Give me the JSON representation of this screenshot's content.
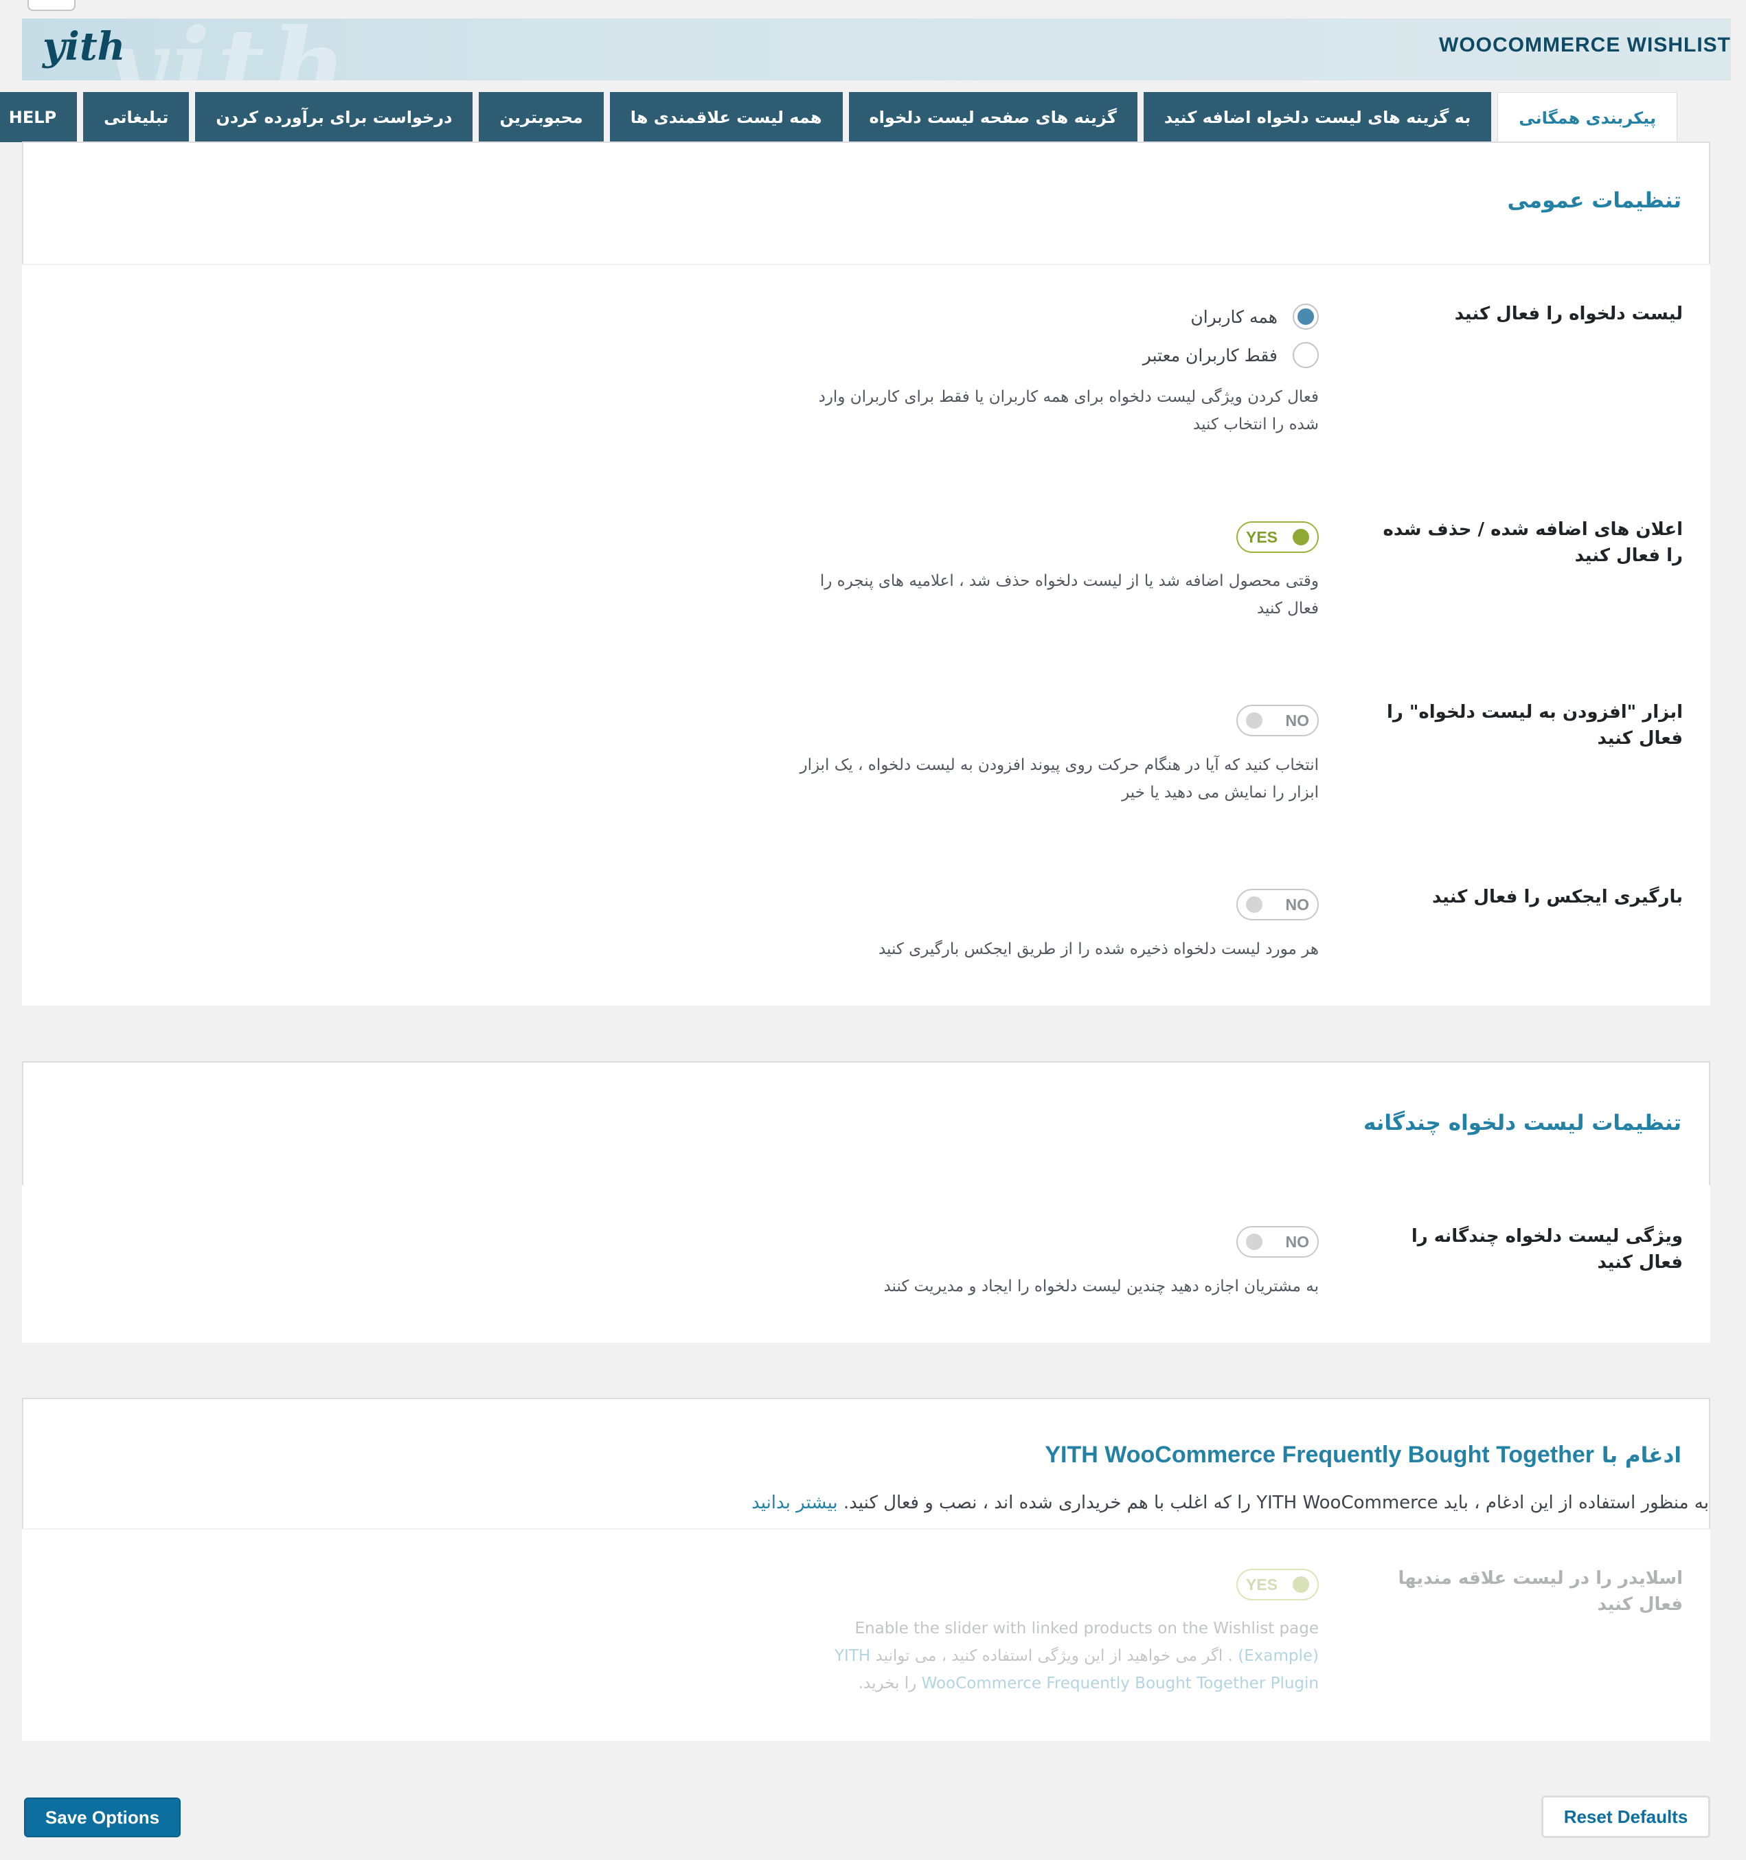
{
  "header": {
    "logo": "yith",
    "title": "WOOCOMMERCE WISHLIST"
  },
  "tabs": [
    {
      "label": "پیکربندی همگانی",
      "active": true
    },
    {
      "label": "به گزینه های لیست دلخواه اضافه کنید"
    },
    {
      "label": "گزینه های صفحه لیست دلخواه"
    },
    {
      "label": "همه لیست علاقمندی ها"
    },
    {
      "label": "محبوبترین"
    },
    {
      "label": "درخواست برای برآورده کردن"
    },
    {
      "label": "تبلیغاتی"
    },
    {
      "label": "HELP"
    }
  ],
  "general": {
    "title": "تنظیمات عمومی",
    "enable_wishlist": {
      "label": "لیست دلخواه را فعال کنید",
      "options": [
        "همه کاربران",
        "فقط کاربران معتبر"
      ],
      "selected": "همه کاربران",
      "description": "فعال کردن ویژگی لیست دلخواه برای همه کاربران یا فقط برای کاربران وارد شده را انتخاب کنید"
    },
    "notices": {
      "label": "اعلان های اضافه شده / حذف شده را فعال کنید",
      "state": "YES",
      "description": "وقتی محصول اضافه شد یا از لیست دلخواه حذف شد ، اعلامیه های پنجره را فعال کنید"
    },
    "tooltip": {
      "label": "ابزار \"افزودن به لیست دلخواه\" را فعال کنید",
      "state": "NO",
      "description": "انتخاب کنید که آیا در هنگام حرکت روی پیوند افزودن به لیست دلخواه ، یک ابزار ابزار را نمایش می دهید یا خیر"
    },
    "ajax": {
      "label": "بارگیری ایجکس را فعال کنید",
      "state": "NO",
      "description": "هر مورد لیست دلخواه ذخیره شده را از طریق ایجکس بارگیری کنید"
    }
  },
  "multi": {
    "title": "تنظیمات لیست دلخواه چندگانه",
    "feature": {
      "label": "ویژگی لیست دلخواه چندگانه را فعال کنید",
      "state": "NO",
      "description": "به مشتریان اجازه دهید چندین لیست دلخواه را ایجاد و مدیریت کنند"
    }
  },
  "integration": {
    "title_prefix": "ادغام با",
    "title_plugin": "YITH WooCommerce Frequently Bought Together",
    "intro_text": "به منظور استفاده از این ادغام ، باید YITH WooCommerce را که اغلب با هم خریداری شده اند ، نصب و فعال کنید.",
    "intro_link": "بیشتر بدانید",
    "slider": {
      "label": "اسلایدر را در لیست علاقه مندیها فعال کنید",
      "state": "YES",
      "desc_en": "Enable the slider with linked products on the Wishlist page",
      "desc_example": "(Example)",
      "desc_fa": ". اگر می خواهید از این ویژگی استفاده کنید ، می توانید",
      "desc_plugin": "YITH WooCommerce Frequently Bought Together Plugin",
      "desc_end": "را بخرید."
    }
  },
  "buttons": {
    "save": "Save Options",
    "reset": "Reset Defaults"
  },
  "colors": {
    "accent": "#2481a6",
    "tab_bg": "#2e5c73",
    "button": "#0d6fa0",
    "toggle_on": "#8fa934"
  }
}
